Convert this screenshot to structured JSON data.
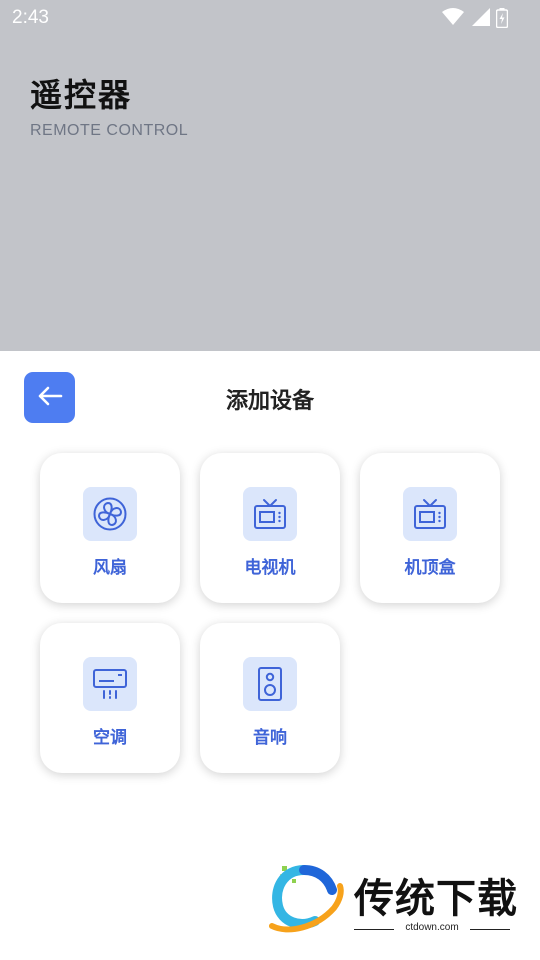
{
  "status_bar": {
    "time": "2:43",
    "icons": [
      "wifi-icon",
      "signal-icon",
      "battery-icon"
    ]
  },
  "header": {
    "title": "遥控器",
    "subtitle": "REMOTE CONTROL"
  },
  "sheet": {
    "title": "添加设备",
    "back_icon": "arrow-left-icon",
    "accent_color": "#4e7df1",
    "devices": [
      {
        "label": "风扇",
        "icon": "fan-icon"
      },
      {
        "label": "电视机",
        "icon": "tv-icon"
      },
      {
        "label": "机顶盒",
        "icon": "tv-icon"
      },
      {
        "label": "空调",
        "icon": "air-conditioner-icon"
      },
      {
        "label": "音响",
        "icon": "speaker-icon"
      }
    ]
  },
  "watermark": {
    "text": "传统下载",
    "domain": "ctdown.com"
  }
}
